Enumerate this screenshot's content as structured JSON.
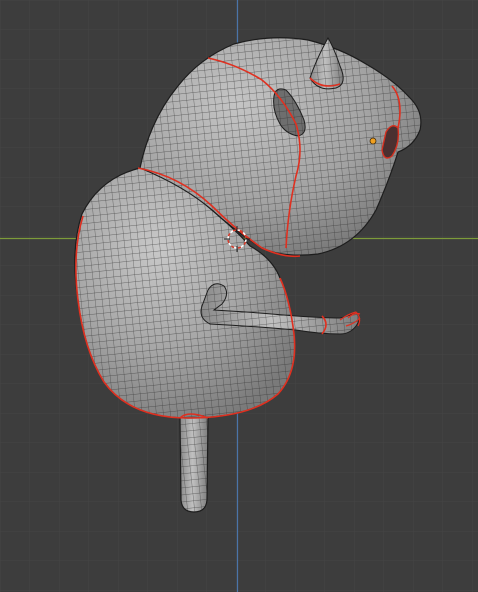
{
  "viewport": {
    "name": "3D Viewport",
    "background": "#3d3d3d",
    "grid_minor_color": "#454545",
    "grid_major_color": "#505050",
    "axis_x_color": "#7d9b3a",
    "axis_y_color": "#4a74a8"
  },
  "mesh": {
    "type": "subdivision-surface",
    "fill_color": "#a9a9a9",
    "wire_color": "#2a2a2a",
    "seam_color": "#e03020",
    "selected": true
  },
  "cursor": {
    "type": "3d-cursor",
    "colors": [
      "#ffffff",
      "#d43c2c"
    ]
  },
  "origin": {
    "type": "object-origin",
    "color": "#f0a020"
  }
}
